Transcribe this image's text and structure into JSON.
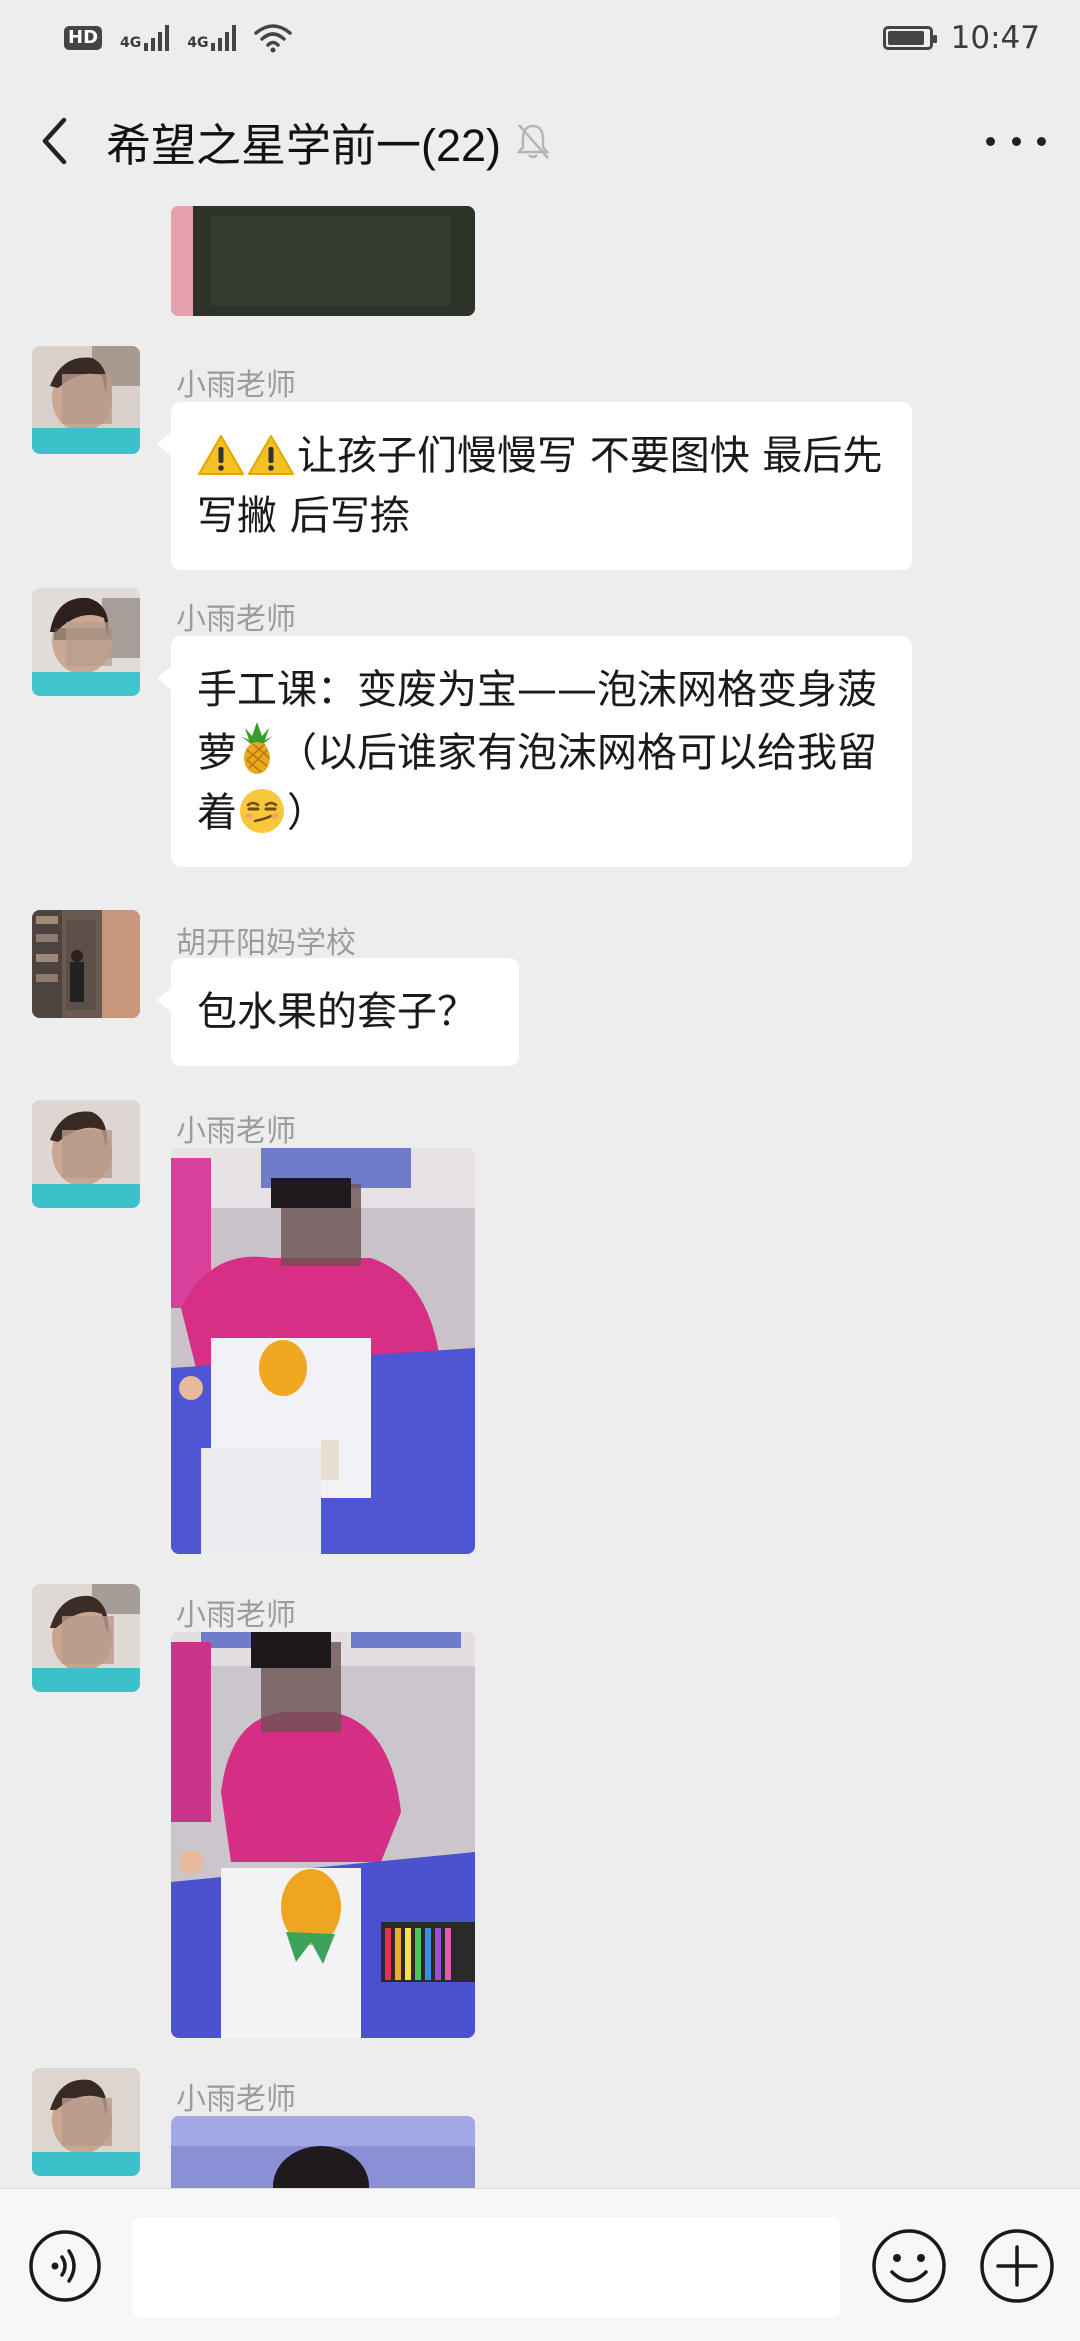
{
  "status_bar": {
    "hd_label": "HD",
    "network_1": "4G",
    "network_2": "4G",
    "time": "10:47",
    "battery_level": 0.9
  },
  "header": {
    "title": "希望之星学前一(22)",
    "icons": [
      "back-arrow-icon",
      "mute-bell-icon",
      "more-dots-icon"
    ]
  },
  "messages": [
    {
      "type": "image",
      "description": "partial image (top cut off)"
    },
    {
      "type": "text",
      "sender": "小雨老师",
      "emoji_prefix": [
        "warning-icon",
        "warning-icon"
      ],
      "text": "让孩子们慢慢写 不要图快 最后先写撇 后写捺"
    },
    {
      "type": "text",
      "sender": "小雨老师",
      "text_part1": "手工课：变废为宝——泡沫网格变身菠萝",
      "emoji_mid": "pineapple-icon",
      "text_part2": "（以后谁家有泡沫网格可以给我留着",
      "emoji_end": "smirk-face-icon",
      "text_part3": "）"
    },
    {
      "type": "text",
      "sender": "胡开阳妈学校",
      "text": "包水果的套子？"
    },
    {
      "type": "image",
      "sender": "小雨老师"
    },
    {
      "type": "image",
      "sender": "小雨老师"
    },
    {
      "type": "image",
      "sender": "小雨老师"
    }
  ],
  "input_bar": {
    "placeholder": "",
    "icons": [
      "voice-icon",
      "emoji-icon",
      "plus-icon"
    ]
  },
  "colors": {
    "background": "#ededed",
    "bubble": "#ffffff",
    "sender_name": "#9c9c9c"
  }
}
